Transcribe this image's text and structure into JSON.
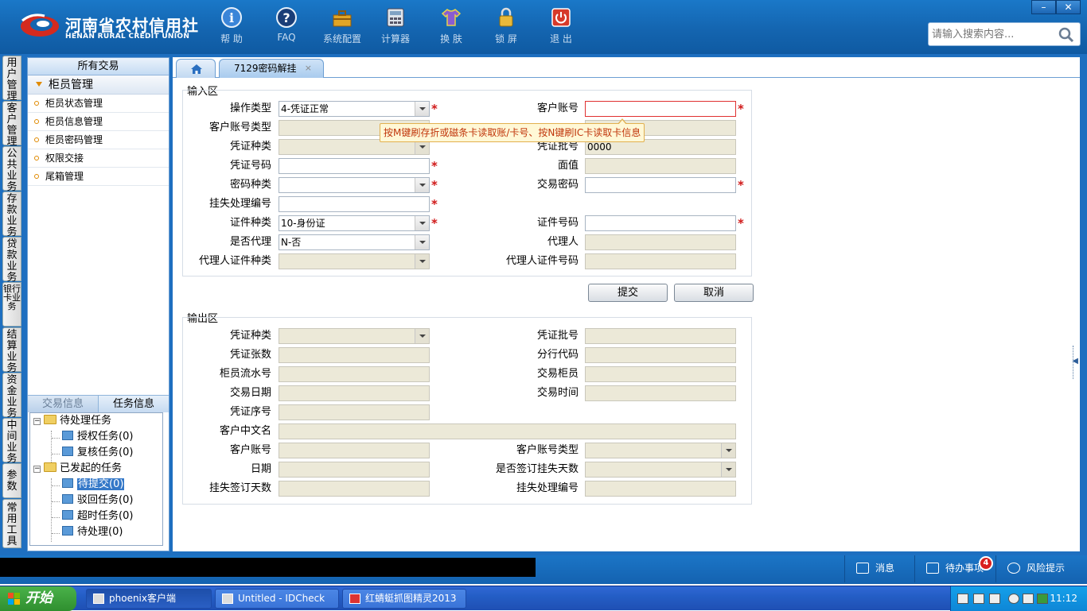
{
  "header": {
    "logo_cn": "河南省农村信用社",
    "logo_en": "HENAN RURAL CREDIT UNION",
    "toolbar": [
      {
        "label": "帮 助",
        "icon": "help-icon"
      },
      {
        "label": "FAQ",
        "icon": "faq-icon"
      },
      {
        "label": "系统配置",
        "icon": "toolbox-icon"
      },
      {
        "label": "计算器",
        "icon": "calculator-icon"
      },
      {
        "label": "换 肤",
        "icon": "shirt-icon"
      },
      {
        "label": "锁 屏",
        "icon": "lock-icon"
      },
      {
        "label": "退 出",
        "icon": "power-icon"
      }
    ],
    "search_placeholder": "请输入搜索内容...",
    "window_minimize": "–",
    "window_close": "✕"
  },
  "vnav": [
    "用户管理",
    "客户管理",
    "公共业务",
    "存款业务",
    "贷款业务",
    "银行卡业务",
    "结算业务",
    "资金业务",
    "中间业务",
    "参数",
    "常用工具"
  ],
  "sidebar": {
    "all_transactions": "所有交易",
    "group": "柜员管理",
    "items": [
      "柜员状态管理",
      "柜员信息管理",
      "柜员密码管理",
      "权限交接",
      "尾箱管理"
    ],
    "tabs": [
      "交易信息",
      "任务信息"
    ],
    "tree": {
      "pending": "待处理任务",
      "pending_children": [
        "授权任务(0)",
        "复核任务(0)"
      ],
      "initiated": "已发起的任务",
      "initiated_children": [
        "待提交(0)",
        "驳回任务(0)",
        "超时任务(0)",
        "待处理(0)"
      ]
    }
  },
  "tabs": {
    "home_icon": "home-icon",
    "active": "7129密码解挂",
    "close": "×"
  },
  "input_section": {
    "title": "输入区",
    "op_type_label": "操作类型",
    "op_type_value": "4-凭证正常",
    "cust_acct_label": "客户账号",
    "cust_acct_value": "",
    "acct_type_label": "客户账号类型",
    "voucher_kind_label": "凭证种类",
    "voucher_batch_label": "凭证批号",
    "voucher_batch_value": "0000",
    "voucher_no_label": "凭证号码",
    "face_value_label": "面值",
    "pwd_kind_label": "密码种类",
    "trade_pwd_label": "交易密码",
    "loss_no_label": "挂失处理编号",
    "id_type_label": "证件种类",
    "id_type_value": "10-身份证",
    "id_no_label": "证件号码",
    "agent_flag_label": "是否代理",
    "agent_flag_value": "N-否",
    "agent_label": "代理人",
    "agent_id_type_label": "代理人证件种类",
    "agent_id_no_label": "代理人证件号码",
    "tooltip": "按M键刷存折或磁条卡读取账/卡号、按N键刷IC卡读取卡信息",
    "required_mark": "*"
  },
  "buttons": {
    "submit": "提交",
    "cancel": "取消"
  },
  "output_section": {
    "title": "输出区",
    "voucher_kind_label": "凭证种类",
    "voucher_batch_label": "凭证批号",
    "voucher_count_label": "凭证张数",
    "branch_code_label": "分行代码",
    "teller_seq_label": "柜员流水号",
    "trade_teller_label": "交易柜员",
    "trade_date_label": "交易日期",
    "trade_time_label": "交易时间",
    "voucher_seq_label": "凭证序号",
    "cust_cn_name_label": "客户中文名",
    "cust_acct_label": "客户账号",
    "cust_acct_type_label": "客户账号类型",
    "date_label": "日期",
    "loss_days_flag_label": "是否签订挂失天数",
    "loss_days_label": "挂失签订天数",
    "loss_no_label": "挂失处理编号"
  },
  "statusbar": {
    "messages": "消息",
    "todo": "待办事项",
    "todo_count": "4",
    "risk": "风险提示"
  },
  "taskbar": {
    "start": "开始",
    "tasks": [
      "phoenix客户端",
      "Untitled - IDCheck",
      "红蜻蜓抓图精灵2013"
    ],
    "clock": "11:12"
  },
  "colors": {
    "header_blue": "#1465b0",
    "required_red": "#d01818",
    "tooltip_bg": "#fff8d6",
    "disabled_field": "#ece9d8"
  }
}
